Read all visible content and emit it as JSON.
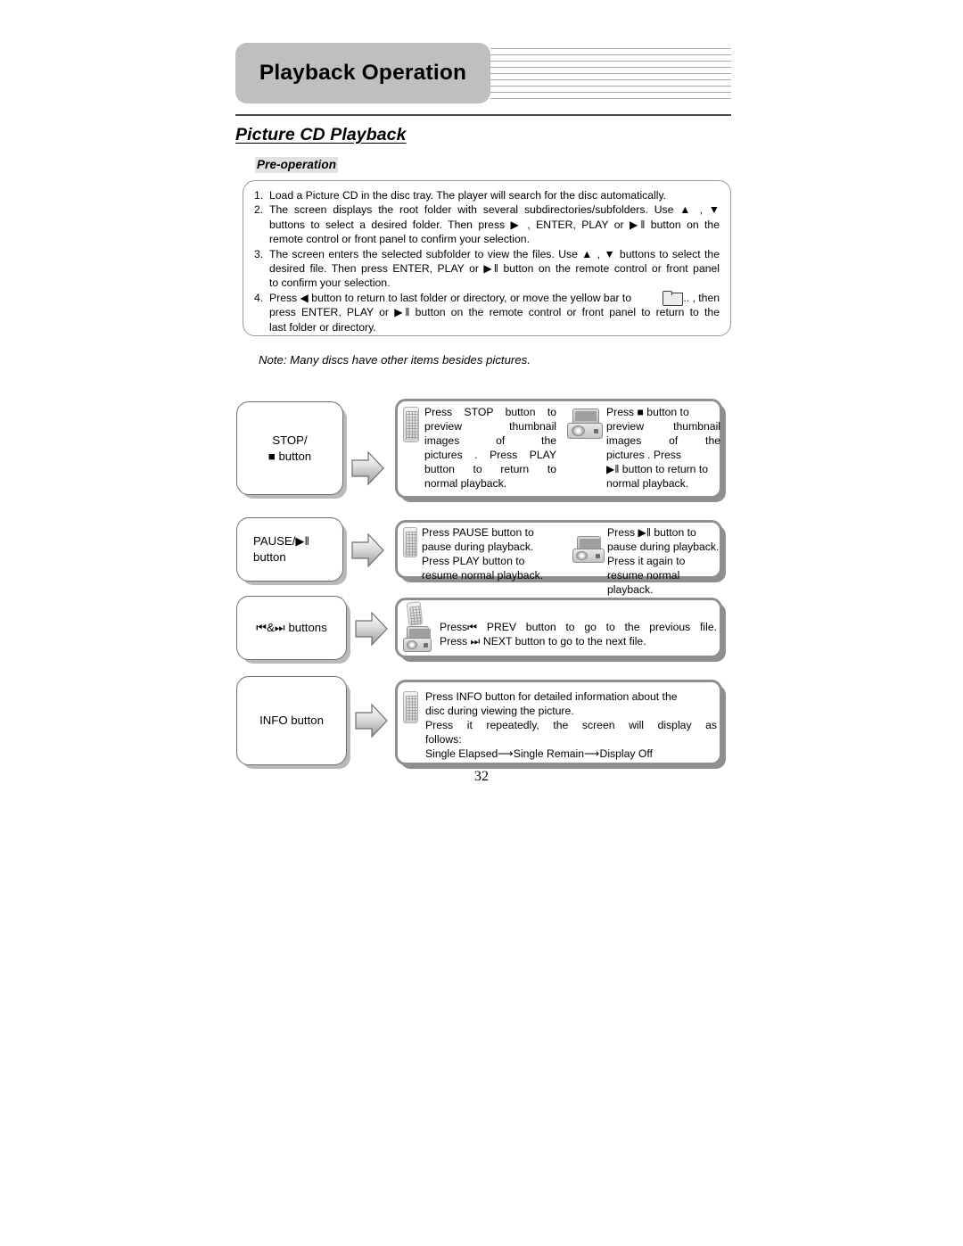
{
  "header": {
    "title": "Playback Operation",
    "decor_line_count": 9
  },
  "section": {
    "title": "Picture CD Playback",
    "subsection": "Pre-operation"
  },
  "preoperation": {
    "items": [
      {
        "num": "1.",
        "lines": [
          "Load a Picture CD in the disc tray. The player will search for the disc automatically."
        ]
      },
      {
        "num": "2.",
        "lines": [
          "The screen displays the root folder with several subdirectories/subfolders. Use ▲ , ▼",
          "buttons to select a desired folder. Then press ▶ , ENTER, PLAY or ▶‖ button on the",
          "remote control or front panel to confirm your selection."
        ]
      },
      {
        "num": "3.",
        "lines": [
          "The screen enters the selected subfolder to view the files. Use ▲ , ▼  buttons to select the",
          "desired file. Then press ENTER, PLAY or ▶‖  button on the remote control or front panel",
          "to confirm your selection."
        ]
      },
      {
        "num": "4.",
        "lines": [
          "Press ◀ button to return to last folder or directory, or move the yellow bar to",
          ".. , then",
          "press ENTER, PLAY or ▶‖ button on the remote control or front panel to return to the",
          "last folder or directory."
        ]
      }
    ]
  },
  "note": "Note: Many discs have other items besides pictures.",
  "flow": {
    "rows": [
      {
        "label_lines": [
          "STOP/",
          "■ button"
        ],
        "arrow_icon": "right-block-arrow-icon",
        "cells": [
          {
            "device_icon": "remote-control-icon",
            "lines": [
              "Press STOP button to",
              "preview thumbnail",
              "images of the",
              "pictures . Press PLAY",
              "button to return to",
              "normal playback."
            ],
            "justified": [
              true,
              true,
              true,
              true,
              true,
              false
            ]
          },
          {
            "device_icon": "dvd-player-icon",
            "lines": [
              "Press ■ button to",
              "preview thumbnail",
              "images of the",
              "pictures . Press",
              "▶‖ button to return to",
              "normal playback."
            ],
            "justified": [
              false,
              true,
              true,
              false,
              false,
              false
            ]
          }
        ]
      },
      {
        "label_lines": [
          "PAUSE/▶‖",
          "button"
        ],
        "arrow_icon": "right-block-arrow-icon",
        "cells": [
          {
            "device_icon": "remote-control-icon",
            "lines": [
              "Press PAUSE button to",
              "pause during playback.",
              "Press PLAY button to",
              "resume normal playback."
            ],
            "justified": [
              false,
              false,
              false,
              false
            ]
          },
          {
            "device_icon": "dvd-player-icon",
            "lines": [
              "Press ▶‖ button to",
              "pause during playback.",
              "Press it again to",
              "resume normal playback."
            ],
            "justified": [
              false,
              false,
              false,
              false
            ]
          }
        ]
      },
      {
        "label_lines": [
          "⏮&⏭ buttons"
        ],
        "arrow_icon": "right-block-arrow-icon",
        "cells": [
          {
            "device_icon": "remote-and-player-icon",
            "lines": [
              "Press⏮  PREV button to go to the previous file.",
              "Press ⏭ NEXT button to go to the next file."
            ],
            "justified": [
              true,
              false
            ]
          }
        ]
      },
      {
        "label_lines": [
          "INFO button"
        ],
        "arrow_icon": "right-block-arrow-icon",
        "cells": [
          {
            "device_icon": "remote-control-icon",
            "lines": [
              "Press INFO button for detailed information about the",
              "disc during viewing the picture.",
              "Press it repeatedly, the screen will display as",
              "follows:",
              "Single Elapsed⟶Single Remain⟶Display Off"
            ],
            "justified": [
              false,
              false,
              true,
              false,
              false
            ]
          }
        ]
      }
    ]
  },
  "page_number": "32"
}
